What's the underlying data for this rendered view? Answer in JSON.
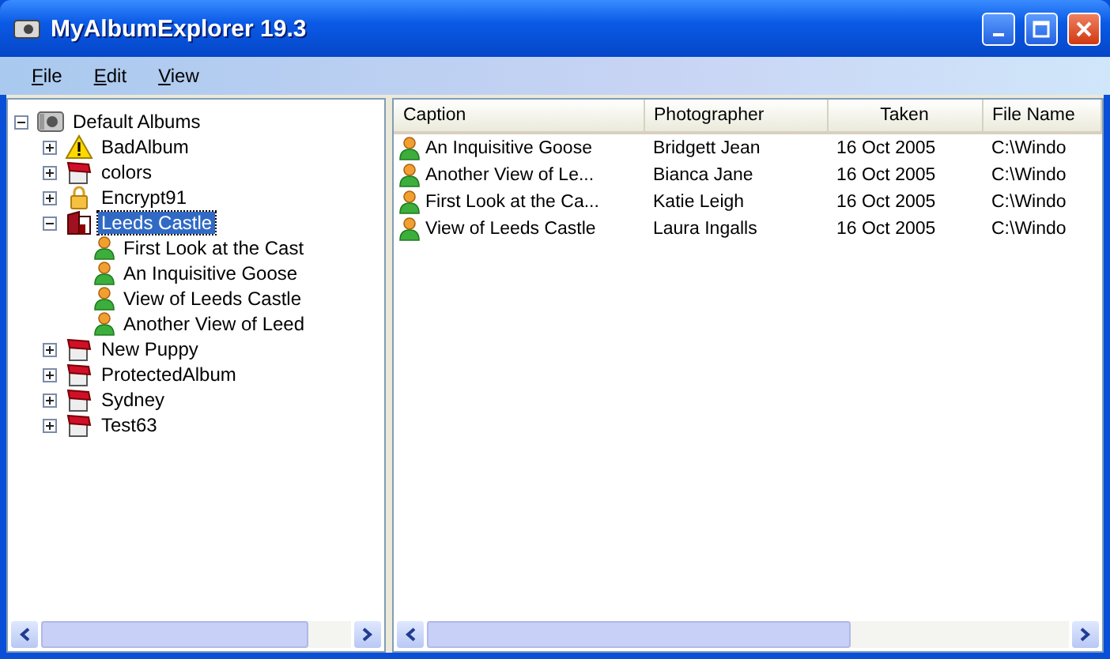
{
  "window": {
    "title": "MyAlbumExplorer 19.3"
  },
  "menu": [
    {
      "label": "File"
    },
    {
      "label": "Edit"
    },
    {
      "label": "View"
    }
  ],
  "tree": [
    {
      "label": "Default Albums",
      "kind": "root",
      "expanded": true,
      "selected": false,
      "children": [
        {
          "label": "BadAlbum",
          "kind": "warning",
          "expanded": false,
          "selected": false
        },
        {
          "label": "colors",
          "kind": "album",
          "expanded": false,
          "selected": false
        },
        {
          "label": "Encrypt91",
          "kind": "locked",
          "expanded": false,
          "selected": false
        },
        {
          "label": "Leeds Castle",
          "kind": "album",
          "expanded": true,
          "selected": true,
          "children": [
            {
              "label": "First Look at the Cast",
              "kind": "photo",
              "selected": false
            },
            {
              "label": "An Inquisitive Goose",
              "kind": "photo",
              "selected": false
            },
            {
              "label": "View of Leeds Castle",
              "kind": "photo",
              "selected": false
            },
            {
              "label": "Another View of Leed",
              "kind": "photo",
              "selected": false
            }
          ]
        },
        {
          "label": "New Puppy",
          "kind": "album",
          "expanded": false,
          "selected": false
        },
        {
          "label": "ProtectedAlbum",
          "kind": "album",
          "expanded": false,
          "selected": false
        },
        {
          "label": "Sydney",
          "kind": "album",
          "expanded": false,
          "selected": false
        },
        {
          "label": "Test63",
          "kind": "album",
          "expanded": false,
          "selected": false
        }
      ]
    }
  ],
  "table": {
    "columns": [
      "Caption",
      "Photographer",
      "Taken",
      "File Name"
    ],
    "rows": [
      {
        "caption": "An Inquisitive Goose",
        "photographer": "Bridgett Jean",
        "taken": "16 Oct 2005",
        "file": "C:\\Windo"
      },
      {
        "caption": "Another View of Le...",
        "photographer": "Bianca Jane",
        "taken": "16 Oct 2005",
        "file": "C:\\Windo"
      },
      {
        "caption": "First Look at the Ca...",
        "photographer": "Katie Leigh",
        "taken": "16 Oct 2005",
        "file": "C:\\Windo"
      },
      {
        "caption": "View of Leeds Castle",
        "photographer": "Laura Ingalls",
        "taken": "16 Oct 2005",
        "file": "C:\\Windo"
      }
    ]
  }
}
